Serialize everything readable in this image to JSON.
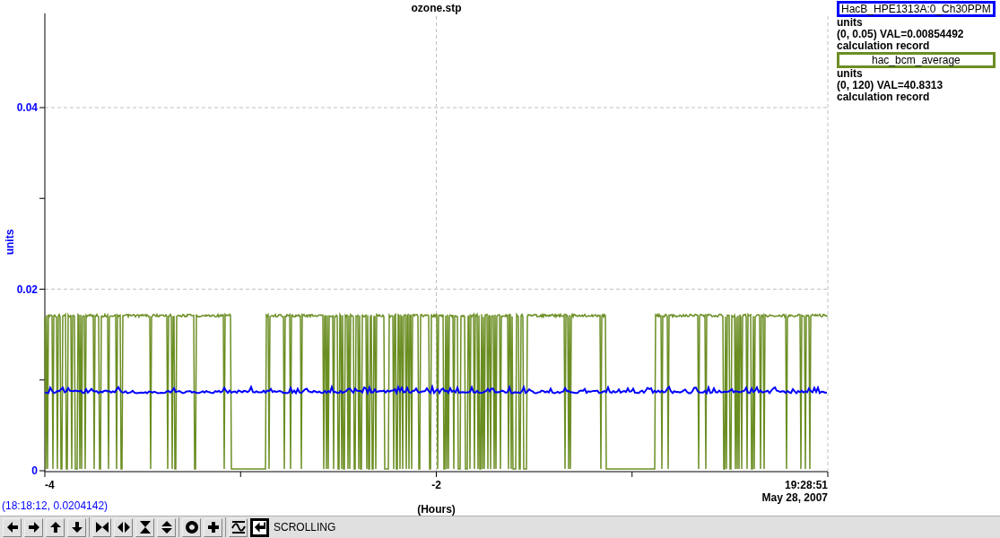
{
  "plot": {
    "title": "ozone.stp",
    "y_axis_label": "units",
    "y_ticks": [
      "0.04",
      "0.02",
      "0"
    ],
    "x_ticks": [
      "-4",
      "-2"
    ],
    "end_time": "19:28:51",
    "end_date": "May 28, 2007",
    "x_axis_label": "(Hours)"
  },
  "legend": [
    {
      "name": "HacB_HPE1313A:0_Ch30PPM",
      "color": "#0000ff",
      "lines": [
        "units",
        "(0, 0.05) VAL=0.00854492",
        "calculation record"
      ]
    },
    {
      "name": "hac_bcm_average",
      "color": "#6b8e23",
      "lines": [
        "units",
        "(0, 120) VAL=40.8313",
        "calculation record"
      ]
    }
  ],
  "cursor_readout": "(18:18:12, 0.0204142)",
  "toolbar": [
    {
      "kind": "left",
      "selected": false
    },
    {
      "kind": "right",
      "selected": false
    },
    {
      "kind": "up",
      "selected": false
    },
    {
      "kind": "down",
      "selected": false
    },
    {
      "kind": "hshrink",
      "selected": false
    },
    {
      "kind": "hgrow",
      "selected": false
    },
    {
      "kind": "vshrink",
      "selected": false
    },
    {
      "kind": "vgrow",
      "selected": false
    },
    {
      "kind": "circle",
      "selected": false
    },
    {
      "kind": "plus",
      "selected": false
    },
    {
      "kind": "wave",
      "selected": false
    },
    {
      "kind": "return",
      "selected": true
    }
  ],
  "mode": "SCROLLING"
}
